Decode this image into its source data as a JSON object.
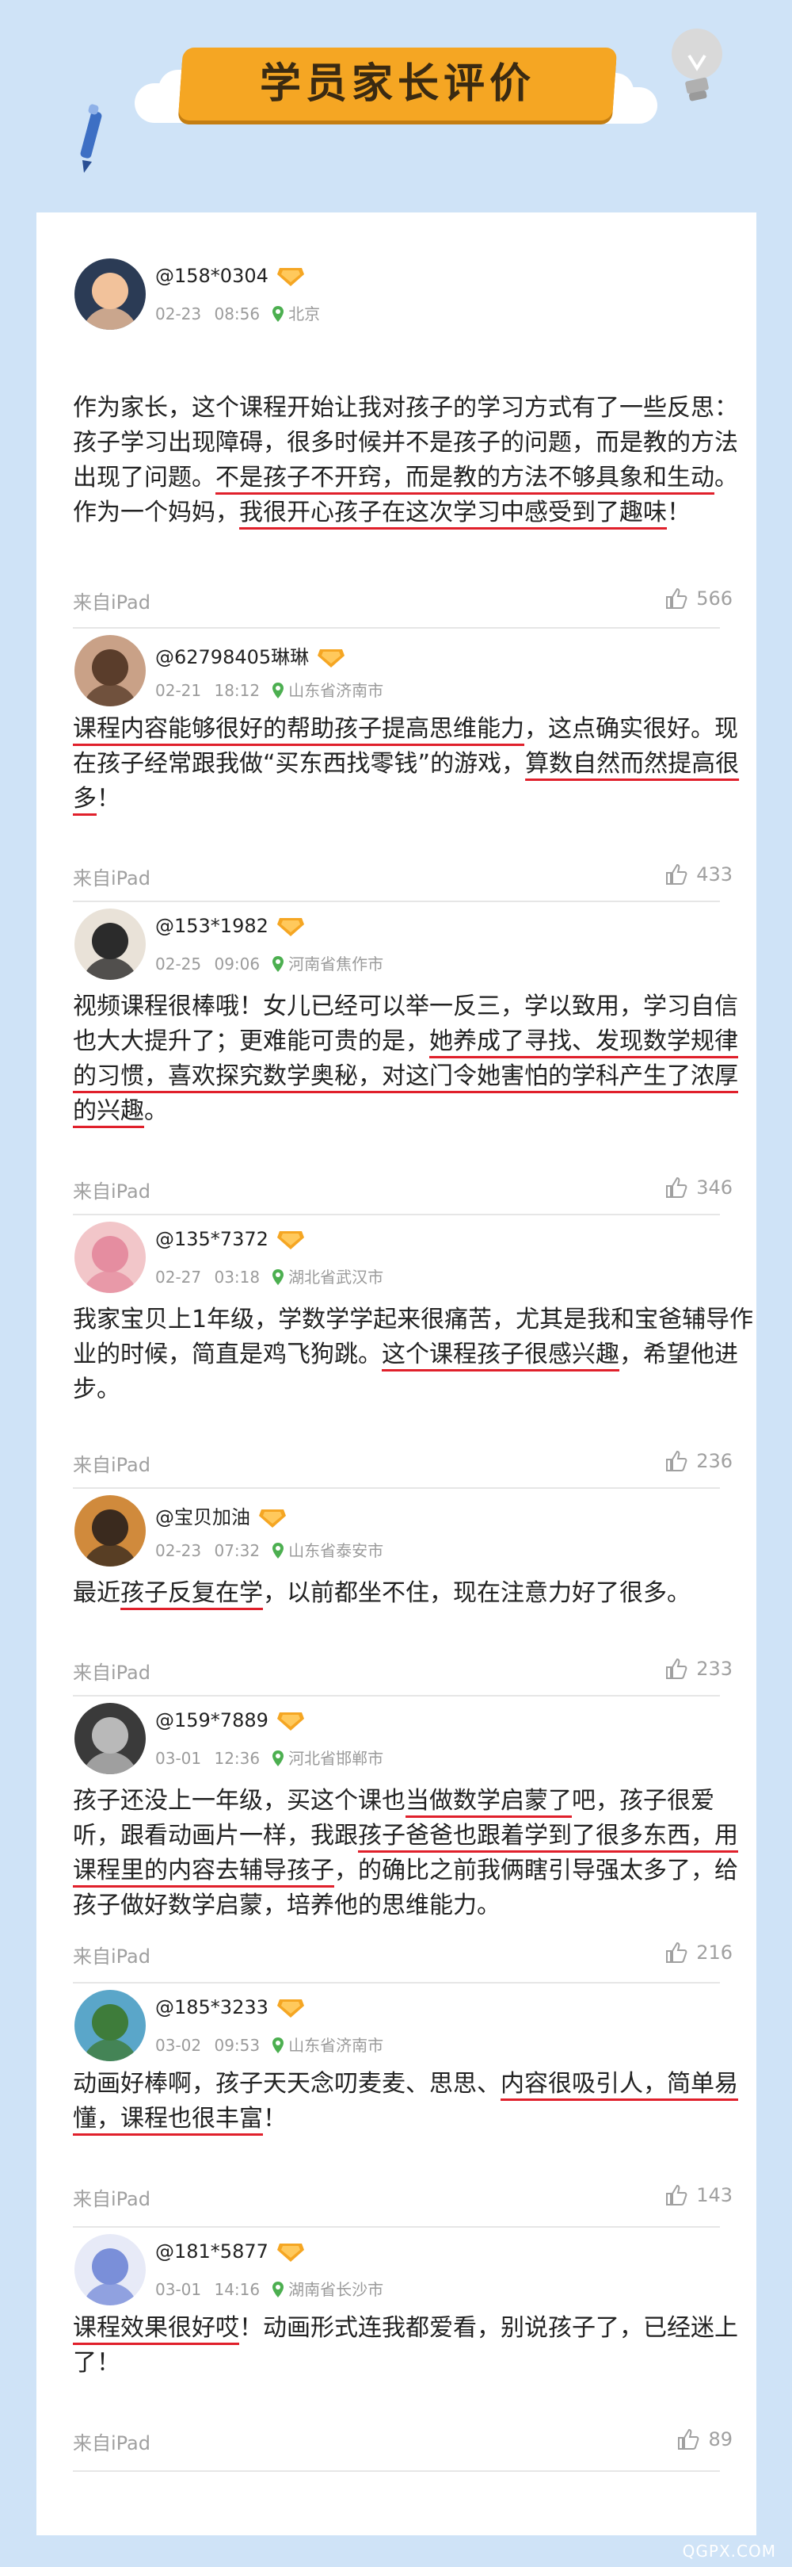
{
  "title": "学员家长评价",
  "from_label": "来自iPad",
  "watermark": "QGPX.COM",
  "colors": {
    "background": "#cfe3f7",
    "banner": "#f5a623",
    "underline": "#e0202b",
    "location": "#4caf50"
  },
  "reviews": [
    {
      "user": "@158*0304",
      "date": "02-23",
      "time": "08:56",
      "location": "北京",
      "likes": "566",
      "parts": [
        {
          "t": "作为家长，这个课程开始让我对孩子的学习方式有了一些反思：孩子学习出现障碍，很多时候并不是孩子的问题，而是教的方法出现了问题。"
        },
        {
          "t": "不是孩子不开窍，而是教的方法不够具象和生动",
          "u": true
        },
        {
          "t": "。作为一个妈妈，"
        },
        {
          "t": "我很开心孩子在这次学习中感受到了趣味",
          "u": true
        },
        {
          "t": "！"
        }
      ]
    },
    {
      "user": "@62798405琳琳",
      "date": "02-21",
      "time": "18:12",
      "location": "山东省济南市",
      "likes": "433",
      "parts": [
        {
          "t": "课程内容能够很好的帮助孩子提高思维能力",
          "u": true
        },
        {
          "t": "，这点确实很好。现在孩子经常跟我做“买东西找零钱”的游戏，"
        },
        {
          "t": "算数自然而然提高很多",
          "u": true
        },
        {
          "t": "！"
        }
      ]
    },
    {
      "user": "@153*1982",
      "date": "02-25",
      "time": "09:06",
      "location": "河南省焦作市",
      "likes": "346",
      "parts": [
        {
          "t": "视频课程很棒哦！女儿已经可以举一反三，学以致用，学习自信也大大提升了；更难能可贵的是，"
        },
        {
          "t": "她养成了寻找、发现数学规律的习惯，喜欢探究数学奥秘，对这门令她害怕的学科产生了浓厚的兴趣",
          "u": true
        },
        {
          "t": "。"
        }
      ]
    },
    {
      "user": "@135*7372",
      "date": "02-27",
      "time": "03:18",
      "location": "湖北省武汉市",
      "likes": "236",
      "parts": [
        {
          "t": "我家宝贝上1年级，学数学学起来很痛苦，尤其是我和宝爸辅导作业的时候，简直是鸡飞狗跳。"
        },
        {
          "t": "这个课程孩子很感兴趣",
          "u": true
        },
        {
          "t": "，希望他进步。"
        }
      ]
    },
    {
      "user": "@宝贝加油",
      "date": "02-23",
      "time": "07:32",
      "location": "山东省泰安市",
      "likes": "233",
      "parts": [
        {
          "t": "最近"
        },
        {
          "t": "孩子反复在学",
          "u": true
        },
        {
          "t": "，以前都坐不住，现在注意力好了很多。"
        }
      ]
    },
    {
      "user": "@159*7889",
      "date": "03-01",
      "time": "12:36",
      "location": "河北省邯郸市",
      "likes": "216",
      "parts": [
        {
          "t": "孩子还没上一年级，买这个课也"
        },
        {
          "t": "当做数学启蒙了",
          "u": true
        },
        {
          "t": "吧，孩子很爱听，跟看动画片一样，我跟"
        },
        {
          "t": "孩子爸爸也跟着学到了很多东西，用课程里的内容去辅导孩子",
          "u": true
        },
        {
          "t": "，的确比之前我俩瞎引导强太多了，给孩子做好数学启蒙，培养他的思维能力。"
        }
      ]
    },
    {
      "user": "@185*3233",
      "date": "03-02",
      "time": "09:53",
      "location": "山东省济南市",
      "likes": "143",
      "parts": [
        {
          "t": "动画好棒啊，孩子天天念叨麦麦、思思、"
        },
        {
          "t": "内容很吸引人，简单易懂，课程也很丰富",
          "u": true
        },
        {
          "t": "！"
        }
      ]
    },
    {
      "user": "@181*5877",
      "date": "03-01",
      "time": "14:16",
      "location": "湖南省长沙市",
      "likes": "89",
      "parts": [
        {
          "t": "课程效果很好哎",
          "u": true
        },
        {
          "t": "！动画形式连我都爱看，别说孩子了，已经迷上了！"
        }
      ]
    }
  ]
}
